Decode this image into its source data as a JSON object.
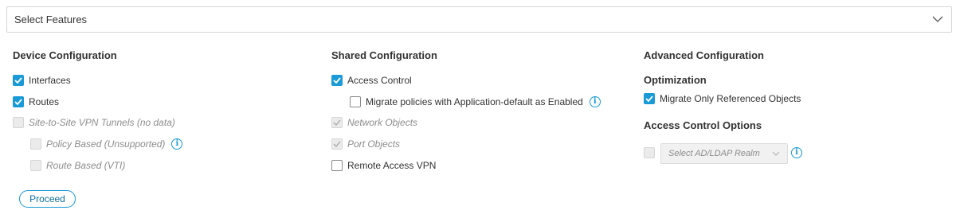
{
  "select_features": {
    "label": "Select Features",
    "icon": "chevron-down-icon"
  },
  "device_configuration": {
    "title": "Device Configuration",
    "items": [
      {
        "label": "Interfaces",
        "checked": true,
        "enabled": true
      },
      {
        "label": "Routes",
        "checked": true,
        "enabled": true
      },
      {
        "label": "Site-to-Site VPN Tunnels (no data)",
        "checked": false,
        "enabled": false
      },
      {
        "label": "Policy Based (Unsupported)",
        "checked": false,
        "enabled": false,
        "info_icon": "info-icon"
      },
      {
        "label": "Route Based (VTI)",
        "checked": false,
        "enabled": false
      }
    ]
  },
  "shared_configuration": {
    "title": "Shared Configuration",
    "items": [
      {
        "label": "Access Control",
        "checked": true,
        "enabled": true
      },
      {
        "label": "Migrate policies with Application-default as Enabled",
        "checked": false,
        "enabled": true,
        "info_icon": "info-icon"
      },
      {
        "label": "Network Objects",
        "checked": true,
        "enabled": false
      },
      {
        "label": "Port Objects",
        "checked": true,
        "enabled": false
      },
      {
        "label": "Remote Access VPN",
        "checked": false,
        "enabled": true
      }
    ]
  },
  "advanced_configuration": {
    "title": "Advanced Configuration",
    "optimization": {
      "title": "Optimization",
      "items": [
        {
          "label": "Migrate Only Referenced Objects",
          "checked": true,
          "enabled": true
        }
      ]
    },
    "access_control_options": {
      "title": "Access Control Options",
      "realm_placeholder": "Select AD/LDAP Realm",
      "realm_enabled": false
    }
  },
  "proceed_label": "Proceed",
  "colors": {
    "accent": "#1a9ad6",
    "disabled_text": "#8c8c8c",
    "border": "#d6d6d6"
  }
}
